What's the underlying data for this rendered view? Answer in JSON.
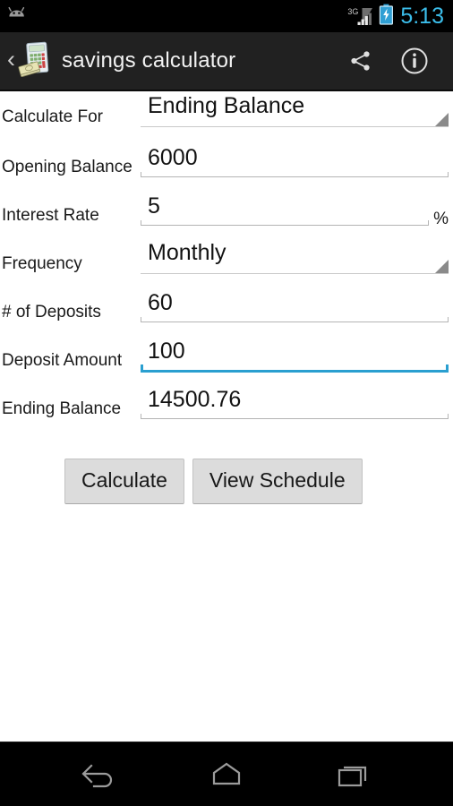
{
  "status_bar": {
    "notification_icon": "android-head-icon",
    "network_label": "3G",
    "signal_icon": "signal-bars-icon",
    "battery_icon": "battery-charging-icon",
    "clock": "5:13",
    "clock_color": "#3bbdea"
  },
  "action_bar": {
    "back_label": "‹",
    "app_icon": "calculator-money-icon",
    "title": "savings calculator",
    "share_icon": "share-icon",
    "info_icon": "info-icon",
    "background_color": "#212121"
  },
  "form": {
    "rows": [
      {
        "label": "Calculate For",
        "value": "Ending Balance",
        "type": "spinner",
        "focused": false,
        "suffix": ""
      },
      {
        "label": "Opening Balance",
        "value": "6000",
        "type": "text",
        "focused": false,
        "suffix": ""
      },
      {
        "label": "Interest Rate",
        "value": "5",
        "type": "text",
        "focused": false,
        "suffix": "%"
      },
      {
        "label": "Frequency",
        "value": "Monthly",
        "type": "spinner",
        "focused": false,
        "suffix": ""
      },
      {
        "label": "# of Deposits",
        "value": "60",
        "type": "text",
        "focused": false,
        "suffix": ""
      },
      {
        "label": "Deposit Amount",
        "value": "100",
        "type": "text",
        "focused": true,
        "suffix": ""
      },
      {
        "label": "Ending Balance",
        "value": "14500.76",
        "type": "text",
        "focused": false,
        "suffix": ""
      }
    ],
    "focus_color": "#2a9fd0",
    "underline_color": "#b4b4b4"
  },
  "buttons": {
    "calculate_label": "Calculate",
    "view_schedule_label": "View Schedule",
    "background_color": "#dcdcdc"
  },
  "nav_bar": {
    "back_icon": "back-arrow-icon",
    "home_icon": "home-icon",
    "recents_icon": "recent-apps-icon"
  }
}
